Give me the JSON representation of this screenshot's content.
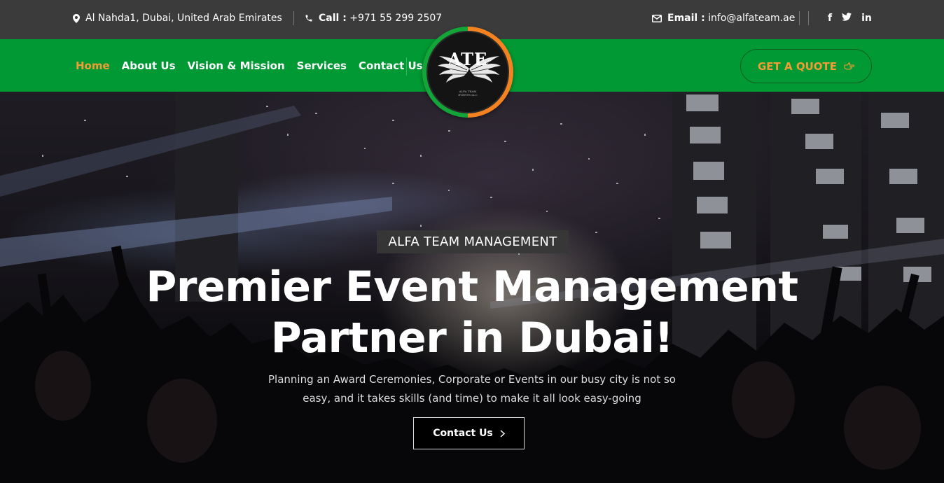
{
  "topbar": {
    "address": "Al Nahda1, Dubai, United Arab Emirates",
    "call_label": "Call :",
    "call_value": "+971 55 299 2507",
    "email_label": "Email :",
    "email_value": "info@alfateam.ae",
    "social": {
      "facebook": "f",
      "twitter": "t",
      "linkedin": "in"
    }
  },
  "nav": {
    "items": [
      {
        "label": "Home",
        "active": true
      },
      {
        "label": "About Us"
      },
      {
        "label": "Vision & Mission"
      },
      {
        "label": "Services"
      },
      {
        "label": "Contact Us"
      }
    ],
    "quote_button": "GET A QUOTE"
  },
  "logo": {
    "text": "ATE",
    "sub_line1": "ALFA TEAM",
    "sub_line2": "EVENTS LLC"
  },
  "hero": {
    "tagline": "ALFA TEAM MANAGEMENT",
    "headline_line1": "Premier Event Management",
    "headline_line2": "Partner in Dubai!",
    "subtext_line1": "Planning an Award Ceremonies, Corporate or Events in our busy city is not so",
    "subtext_line2": "easy, and it takes skills (and time) to make it all look easy-going",
    "cta_label": "Contact Us"
  },
  "colors": {
    "topbar_bg": "#3b3b3b",
    "nav_bg": "#009933",
    "accent_orange": "#f39c35",
    "logo_orange": "#f58220",
    "logo_green": "#13a538"
  },
  "icons": {
    "address": "map-pin-icon",
    "call": "phone-icon",
    "email": "envelope-icon",
    "quote": "hand-point-right-icon",
    "cta": "chevron-right-icon"
  }
}
